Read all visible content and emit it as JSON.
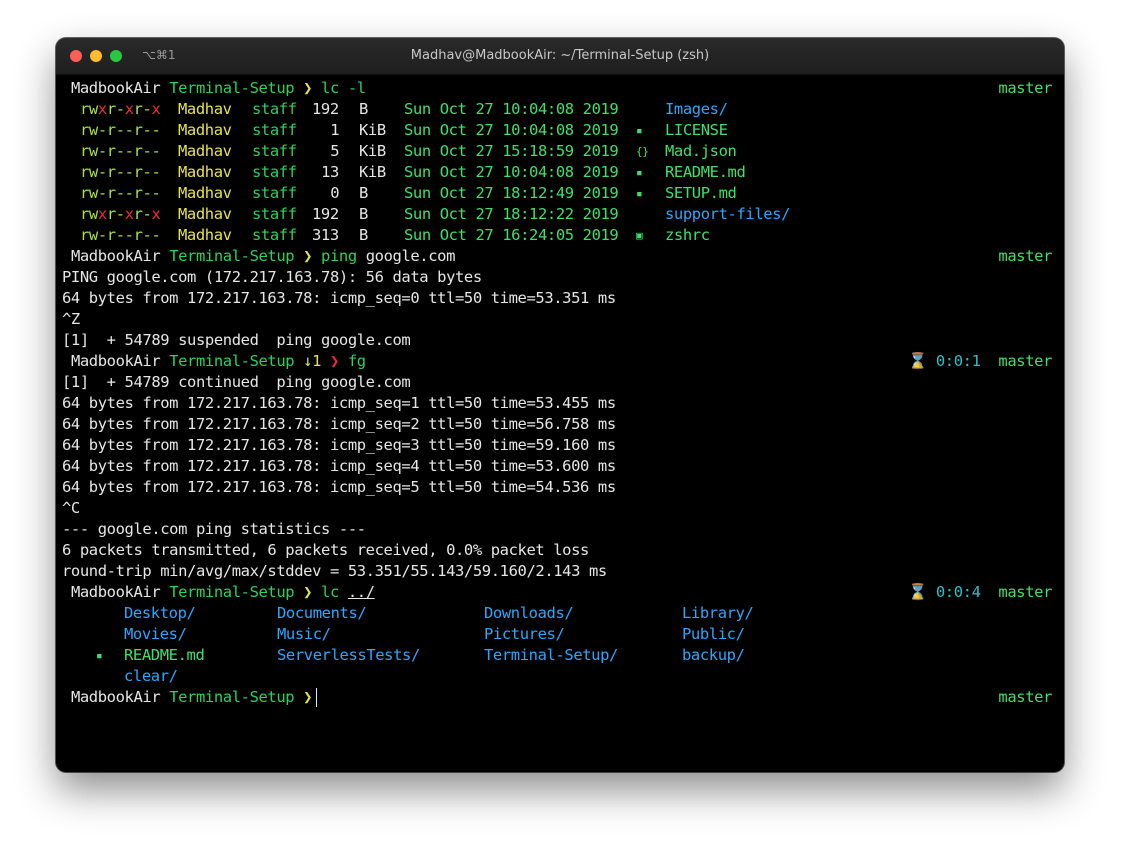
{
  "window": {
    "title": "Madhav@MadbookAir: ~/Terminal-Setup (zsh)",
    "shortcut": "⌥⌘1"
  },
  "prompt": {
    "apple": "",
    "host": "MadbookAir",
    "dir": "Terminal-Setup",
    "arrow": "❯",
    "branch_icon": "",
    "branch": "master",
    "hourglass": "⌛"
  },
  "cmd1": "lc -l",
  "listing": [
    {
      "perm": [
        "rw",
        "x",
        "r-",
        "x",
        "r-",
        "x"
      ],
      "owner": "Madhav",
      "group": "staff",
      "size": "192",
      "unit": "B",
      "date": "Sun Oct 27 10:04:08 2019",
      "icon": "folder-icon",
      "glyph": "",
      "name": "Images/",
      "kind": "dir"
    },
    {
      "perm": [
        "rw-r--r--"
      ],
      "owner": "Madhav",
      "group": "staff",
      "size": "1",
      "unit": "KiB",
      "date": "Sun Oct 27 10:04:08 2019",
      "icon": "file-icon",
      "glyph": "▪",
      "name": "LICENSE",
      "kind": "file"
    },
    {
      "perm": [
        "rw-r--r--"
      ],
      "owner": "Madhav",
      "group": "staff",
      "size": "5",
      "unit": "KiB",
      "date": "Sun Oct 27 15:18:59 2019",
      "icon": "json-icon",
      "glyph": "{}",
      "name": "Mad.json",
      "kind": "file"
    },
    {
      "perm": [
        "rw-r--r--"
      ],
      "owner": "Madhav",
      "group": "staff",
      "size": "13",
      "unit": "KiB",
      "date": "Sun Oct 27 10:04:08 2019",
      "icon": "markdown-icon",
      "glyph": "▪",
      "name": "README.md",
      "kind": "file"
    },
    {
      "perm": [
        "rw-r--r--"
      ],
      "owner": "Madhav",
      "group": "staff",
      "size": "0",
      "unit": "B",
      "date": "Sun Oct 27 18:12:49 2019",
      "icon": "markdown-icon",
      "glyph": "▪",
      "name": "SETUP.md",
      "kind": "file"
    },
    {
      "perm": [
        "rw",
        "x",
        "r-",
        "x",
        "r-",
        "x"
      ],
      "owner": "Madhav",
      "group": "staff",
      "size": "192",
      "unit": "B",
      "date": "Sun Oct 27 18:12:22 2019",
      "icon": "folder-icon",
      "glyph": "",
      "name": "support-files/",
      "kind": "dir"
    },
    {
      "perm": [
        "rw-r--r--"
      ],
      "owner": "Madhav",
      "group": "staff",
      "size": "313",
      "unit": "B",
      "date": "Sun Oct 27 16:24:05 2019",
      "icon": "shell-icon",
      "glyph": "▣",
      "name": "zshrc",
      "kind": "file"
    }
  ],
  "cmd2": {
    "cmd": "ping",
    "arg": "google.com"
  },
  "ping_lines1": [
    "PING google.com (172.217.163.78): 56 data bytes",
    "64 bytes from 172.217.163.78: icmp_seq=0 ttl=50 time=53.351 ms",
    "^Z",
    "[1]  + 54789 suspended  ping google.com"
  ],
  "cmd3": {
    "jobs": "↓1",
    "arrow": "❯",
    "cmd": "fg",
    "timer": "0:0:1"
  },
  "ping_lines2": [
    "[1]  + 54789 continued  ping google.com",
    "64 bytes from 172.217.163.78: icmp_seq=1 ttl=50 time=53.455 ms",
    "64 bytes from 172.217.163.78: icmp_seq=2 ttl=50 time=56.758 ms",
    "64 bytes from 172.217.163.78: icmp_seq=3 ttl=50 time=59.160 ms",
    "64 bytes from 172.217.163.78: icmp_seq=4 ttl=50 time=53.600 ms",
    "64 bytes from 172.217.163.78: icmp_seq=5 ttl=50 time=54.536 ms",
    "^C",
    "--- google.com ping statistics ---",
    "6 packets transmitted, 6 packets received, 0.0% packet loss",
    "round-trip min/avg/max/stddev = 53.351/55.143/59.160/2.143 ms"
  ],
  "cmd4": {
    "cmd": "lc",
    "arg": "../",
    "timer": "0:0:4"
  },
  "grid": [
    [
      {
        "name": "Desktop/",
        "kind": "dir"
      },
      {
        "name": "Documents/",
        "kind": "dir"
      },
      {
        "name": "Downloads/",
        "kind": "dir"
      },
      {
        "name": "Library/",
        "kind": "dir"
      }
    ],
    [
      {
        "name": "Movies/",
        "kind": "dir"
      },
      {
        "name": "Music/",
        "kind": "dir"
      },
      {
        "name": "Pictures/",
        "kind": "dir"
      },
      {
        "name": "Public/",
        "kind": "dir"
      }
    ],
    [
      {
        "name": "README.md",
        "kind": "file"
      },
      {
        "name": "ServerlessTests/",
        "kind": "dir"
      },
      {
        "name": "Terminal-Setup/",
        "kind": "dir"
      },
      {
        "name": "backup/",
        "kind": "dir"
      }
    ],
    [
      {
        "name": "clear/",
        "kind": "dir"
      }
    ]
  ],
  "colors": {
    "host": "#e6e6e6",
    "dir": "#27d35a",
    "arrow": "#e8e24a",
    "error_arrow": "#f0293a",
    "directory": "#2aa7ff",
    "file": "#3ee06a",
    "timer": "#2bc0c8"
  }
}
